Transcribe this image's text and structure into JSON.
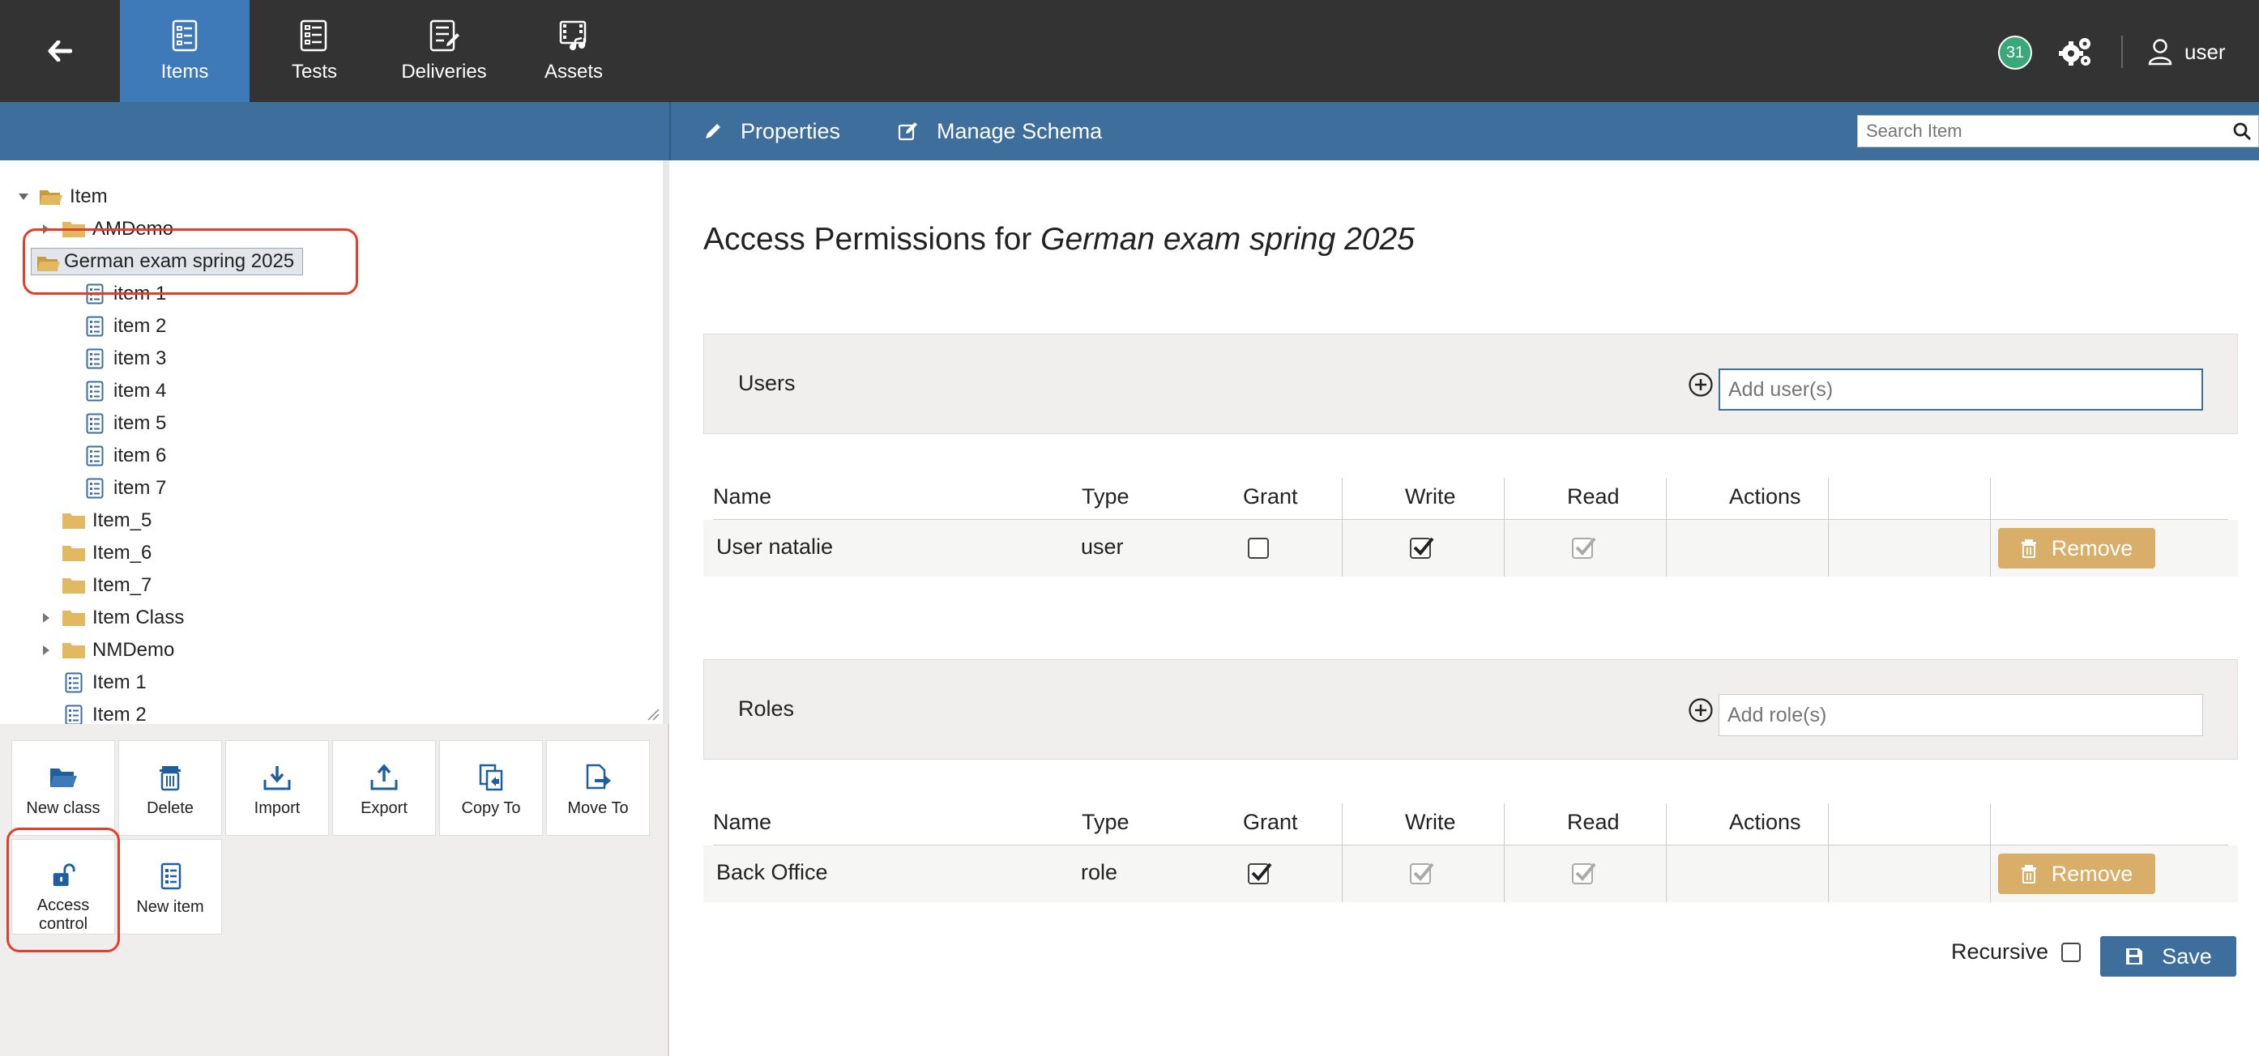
{
  "nav": {
    "tabs": [
      {
        "label": "Items",
        "icon": "items-icon",
        "active": true
      },
      {
        "label": "Tests",
        "icon": "tests-icon",
        "active": false
      },
      {
        "label": "Deliveries",
        "icon": "deliveries-icon",
        "active": false
      },
      {
        "label": "Assets",
        "icon": "assets-icon",
        "active": false
      }
    ],
    "notification_count": "31",
    "user_label": "user"
  },
  "subbar": {
    "properties_label": "Properties",
    "manage_schema_label": "Manage Schema",
    "search_placeholder": "Search Item"
  },
  "tree": {
    "root": "Item",
    "nodes": [
      {
        "label": "AMDemo",
        "type": "class",
        "expandable": true
      },
      {
        "label": "German exam spring 2025",
        "type": "class",
        "expanded": true,
        "selected": true
      },
      {
        "label": "item 1",
        "type": "item"
      },
      {
        "label": "item 2",
        "type": "item"
      },
      {
        "label": "item 3",
        "type": "item"
      },
      {
        "label": "item 4",
        "type": "item"
      },
      {
        "label": "item 5",
        "type": "item"
      },
      {
        "label": "item 6",
        "type": "item"
      },
      {
        "label": "item 7",
        "type": "item"
      },
      {
        "label": "Item_5",
        "type": "class"
      },
      {
        "label": "Item_6",
        "type": "class"
      },
      {
        "label": "Item_7",
        "type": "class"
      },
      {
        "label": "Item Class",
        "type": "class",
        "expandable": true
      },
      {
        "label": "NMDemo",
        "type": "class",
        "expandable": true
      },
      {
        "label": "Item 1",
        "type": "item"
      },
      {
        "label": "Item 2",
        "type": "item"
      }
    ]
  },
  "toolbar": {
    "new_class": "New class",
    "delete": "Delete",
    "import": "Import",
    "export": "Export",
    "copy_to": "Copy To",
    "move_to": "Move To",
    "access_control_line1": "Access",
    "access_control_line2": "control",
    "new_item": "New item"
  },
  "main": {
    "title_prefix": "Access Permissions for",
    "title_subject": "German exam spring 2025",
    "users_section": {
      "label": "Users",
      "placeholder": "Add user(s)"
    },
    "roles_section": {
      "label": "Roles",
      "placeholder": "Add role(s)"
    },
    "columns": [
      "Name",
      "Type",
      "Grant",
      "Write",
      "Read",
      "Actions"
    ],
    "users_rows": [
      {
        "name": "User natalie",
        "type": "user",
        "grant": false,
        "write": true,
        "read": true,
        "read_disabled": true,
        "action": "Remove"
      }
    ],
    "roles_rows": [
      {
        "name": "Back Office",
        "type": "role",
        "grant": true,
        "write": true,
        "write_disabled": true,
        "read": true,
        "read_disabled": true,
        "action": "Remove"
      }
    ],
    "recursive_label": "Recursive",
    "save_label": "Save"
  },
  "colors": {
    "topnav_bg": "#333333",
    "active_tab": "#3e7ab8",
    "subbar_bg": "#3e6f9c",
    "remove_btn": "#d8ae68",
    "badge": "#3aa87a",
    "highlight": "#e0402a"
  }
}
